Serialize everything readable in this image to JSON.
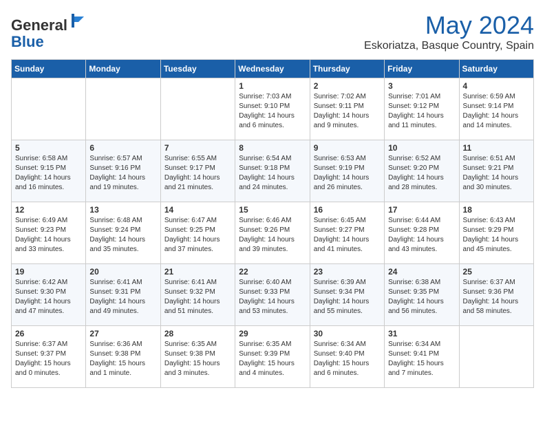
{
  "header": {
    "logo_general": "General",
    "logo_blue": "Blue",
    "month": "May 2024",
    "location": "Eskoriatza, Basque Country, Spain"
  },
  "weekdays": [
    "Sunday",
    "Monday",
    "Tuesday",
    "Wednesday",
    "Thursday",
    "Friday",
    "Saturday"
  ],
  "weeks": [
    [
      {
        "day": "",
        "info": ""
      },
      {
        "day": "",
        "info": ""
      },
      {
        "day": "",
        "info": ""
      },
      {
        "day": "1",
        "info": "Sunrise: 7:03 AM\nSunset: 9:10 PM\nDaylight: 14 hours and 6 minutes."
      },
      {
        "day": "2",
        "info": "Sunrise: 7:02 AM\nSunset: 9:11 PM\nDaylight: 14 hours and 9 minutes."
      },
      {
        "day": "3",
        "info": "Sunrise: 7:01 AM\nSunset: 9:12 PM\nDaylight: 14 hours and 11 minutes."
      },
      {
        "day": "4",
        "info": "Sunrise: 6:59 AM\nSunset: 9:14 PM\nDaylight: 14 hours and 14 minutes."
      }
    ],
    [
      {
        "day": "5",
        "info": "Sunrise: 6:58 AM\nSunset: 9:15 PM\nDaylight: 14 hours and 16 minutes."
      },
      {
        "day": "6",
        "info": "Sunrise: 6:57 AM\nSunset: 9:16 PM\nDaylight: 14 hours and 19 minutes."
      },
      {
        "day": "7",
        "info": "Sunrise: 6:55 AM\nSunset: 9:17 PM\nDaylight: 14 hours and 21 minutes."
      },
      {
        "day": "8",
        "info": "Sunrise: 6:54 AM\nSunset: 9:18 PM\nDaylight: 14 hours and 24 minutes."
      },
      {
        "day": "9",
        "info": "Sunrise: 6:53 AM\nSunset: 9:19 PM\nDaylight: 14 hours and 26 minutes."
      },
      {
        "day": "10",
        "info": "Sunrise: 6:52 AM\nSunset: 9:20 PM\nDaylight: 14 hours and 28 minutes."
      },
      {
        "day": "11",
        "info": "Sunrise: 6:51 AM\nSunset: 9:21 PM\nDaylight: 14 hours and 30 minutes."
      }
    ],
    [
      {
        "day": "12",
        "info": "Sunrise: 6:49 AM\nSunset: 9:23 PM\nDaylight: 14 hours and 33 minutes."
      },
      {
        "day": "13",
        "info": "Sunrise: 6:48 AM\nSunset: 9:24 PM\nDaylight: 14 hours and 35 minutes."
      },
      {
        "day": "14",
        "info": "Sunrise: 6:47 AM\nSunset: 9:25 PM\nDaylight: 14 hours and 37 minutes."
      },
      {
        "day": "15",
        "info": "Sunrise: 6:46 AM\nSunset: 9:26 PM\nDaylight: 14 hours and 39 minutes."
      },
      {
        "day": "16",
        "info": "Sunrise: 6:45 AM\nSunset: 9:27 PM\nDaylight: 14 hours and 41 minutes."
      },
      {
        "day": "17",
        "info": "Sunrise: 6:44 AM\nSunset: 9:28 PM\nDaylight: 14 hours and 43 minutes."
      },
      {
        "day": "18",
        "info": "Sunrise: 6:43 AM\nSunset: 9:29 PM\nDaylight: 14 hours and 45 minutes."
      }
    ],
    [
      {
        "day": "19",
        "info": "Sunrise: 6:42 AM\nSunset: 9:30 PM\nDaylight: 14 hours and 47 minutes."
      },
      {
        "day": "20",
        "info": "Sunrise: 6:41 AM\nSunset: 9:31 PM\nDaylight: 14 hours and 49 minutes."
      },
      {
        "day": "21",
        "info": "Sunrise: 6:41 AM\nSunset: 9:32 PM\nDaylight: 14 hours and 51 minutes."
      },
      {
        "day": "22",
        "info": "Sunrise: 6:40 AM\nSunset: 9:33 PM\nDaylight: 14 hours and 53 minutes."
      },
      {
        "day": "23",
        "info": "Sunrise: 6:39 AM\nSunset: 9:34 PM\nDaylight: 14 hours and 55 minutes."
      },
      {
        "day": "24",
        "info": "Sunrise: 6:38 AM\nSunset: 9:35 PM\nDaylight: 14 hours and 56 minutes."
      },
      {
        "day": "25",
        "info": "Sunrise: 6:37 AM\nSunset: 9:36 PM\nDaylight: 14 hours and 58 minutes."
      }
    ],
    [
      {
        "day": "26",
        "info": "Sunrise: 6:37 AM\nSunset: 9:37 PM\nDaylight: 15 hours and 0 minutes."
      },
      {
        "day": "27",
        "info": "Sunrise: 6:36 AM\nSunset: 9:38 PM\nDaylight: 15 hours and 1 minute."
      },
      {
        "day": "28",
        "info": "Sunrise: 6:35 AM\nSunset: 9:38 PM\nDaylight: 15 hours and 3 minutes."
      },
      {
        "day": "29",
        "info": "Sunrise: 6:35 AM\nSunset: 9:39 PM\nDaylight: 15 hours and 4 minutes."
      },
      {
        "day": "30",
        "info": "Sunrise: 6:34 AM\nSunset: 9:40 PM\nDaylight: 15 hours and 6 minutes."
      },
      {
        "day": "31",
        "info": "Sunrise: 6:34 AM\nSunset: 9:41 PM\nDaylight: 15 hours and 7 minutes."
      },
      {
        "day": "",
        "info": ""
      }
    ]
  ]
}
